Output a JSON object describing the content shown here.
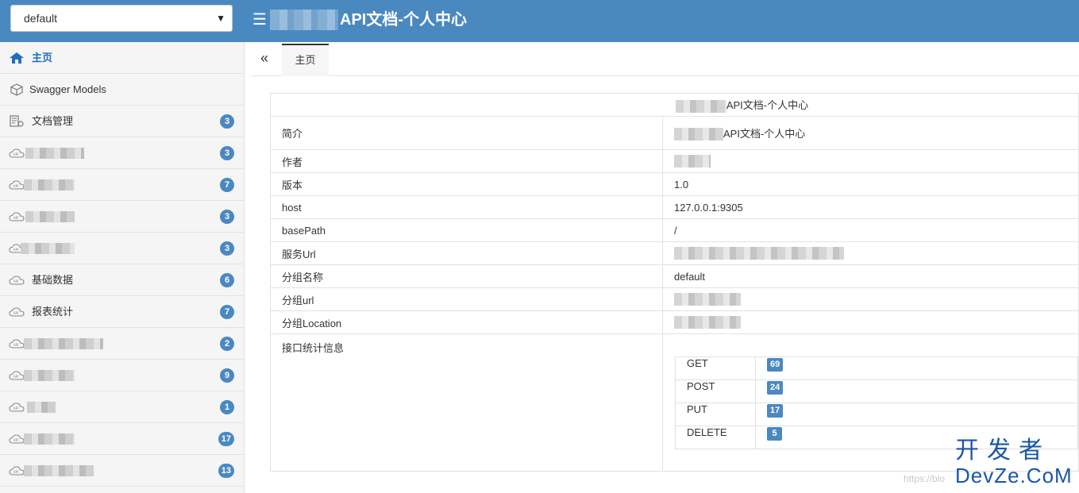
{
  "header": {
    "group_select": "default",
    "menu_icon": "menu-icon",
    "title": "API文档-个人中心"
  },
  "sidebar": {
    "items": [
      {
        "label": "主页",
        "icon": "home-icon",
        "badge": ""
      },
      {
        "label": "Swagger Models",
        "icon": "cube-icon",
        "badge": ""
      },
      {
        "label": "文档管理",
        "icon": "doc-settings-icon",
        "badge": "3"
      },
      {
        "label": "",
        "icon": "api-cloud-icon",
        "badge": "3"
      },
      {
        "label": "",
        "icon": "api-cloud-icon",
        "badge": "7"
      },
      {
        "label": "",
        "icon": "api-cloud-icon",
        "badge": "3"
      },
      {
        "label": "",
        "icon": "api-cloud-icon",
        "badge": "3"
      },
      {
        "label": "基础数据",
        "icon": "api-cloud-icon",
        "badge": "6"
      },
      {
        "label": "报表统计",
        "icon": "api-cloud-icon",
        "badge": "7"
      },
      {
        "label": "",
        "icon": "api-cloud-icon",
        "badge": "2"
      },
      {
        "label": "",
        "icon": "api-cloud-icon",
        "badge": "9"
      },
      {
        "label": "",
        "icon": "api-cloud-icon",
        "badge": "1"
      },
      {
        "label": "",
        "icon": "api-cloud-icon",
        "badge": "17"
      },
      {
        "label": "",
        "icon": "api-cloud-icon",
        "badge": "13"
      }
    ]
  },
  "tabs": {
    "collapse_icon": "double-chevron-left-icon",
    "items": [
      {
        "label": "主页"
      }
    ]
  },
  "info": {
    "title": "API文档-个人中心",
    "rows": [
      {
        "key": "简介",
        "value": "API文档-个人中心"
      },
      {
        "key": "作者",
        "value": ""
      },
      {
        "key": "版本",
        "value": "1.0"
      },
      {
        "key": "host",
        "value": "127.0.0.1:9305"
      },
      {
        "key": "basePath",
        "value": "/"
      },
      {
        "key": "服务Url",
        "value": ""
      },
      {
        "key": "分组名称",
        "value": "default"
      },
      {
        "key": "分组url",
        "value": ""
      },
      {
        "key": "分组Location",
        "value": ""
      },
      {
        "key": "接口统计信息",
        "value": ""
      }
    ],
    "stats": [
      {
        "method": "GET",
        "count": "69"
      },
      {
        "method": "POST",
        "count": "24"
      },
      {
        "method": "PUT",
        "count": "17"
      },
      {
        "method": "DELETE",
        "count": "5"
      }
    ]
  },
  "watermark": {
    "url": "https://blo",
    "cn": "开发者",
    "en": "DevZe.CoM"
  },
  "colors": {
    "header_bg": "#4a89c0",
    "badge_bg": "#4a89c0",
    "active_link": "#1e6fbf"
  }
}
